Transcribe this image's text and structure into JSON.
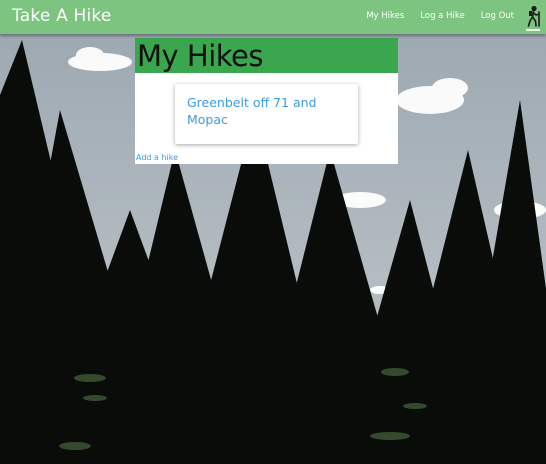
{
  "navbar": {
    "brand": "Take A Hike",
    "links": [
      {
        "label": "My Hikes"
      },
      {
        "label": "Log a Hike"
      },
      {
        "label": "Log Out"
      }
    ],
    "icon": "hiker-icon"
  },
  "main": {
    "title": "My Hikes",
    "hikes": [
      {
        "title": "Greenbelt off 71 and Mopac"
      }
    ],
    "add_link": "Add a hike"
  },
  "colors": {
    "navbar": "#7cc47f",
    "title_bar": "#3aa64d",
    "link": "#3d9be0",
    "trees": "#0a0c0a"
  }
}
